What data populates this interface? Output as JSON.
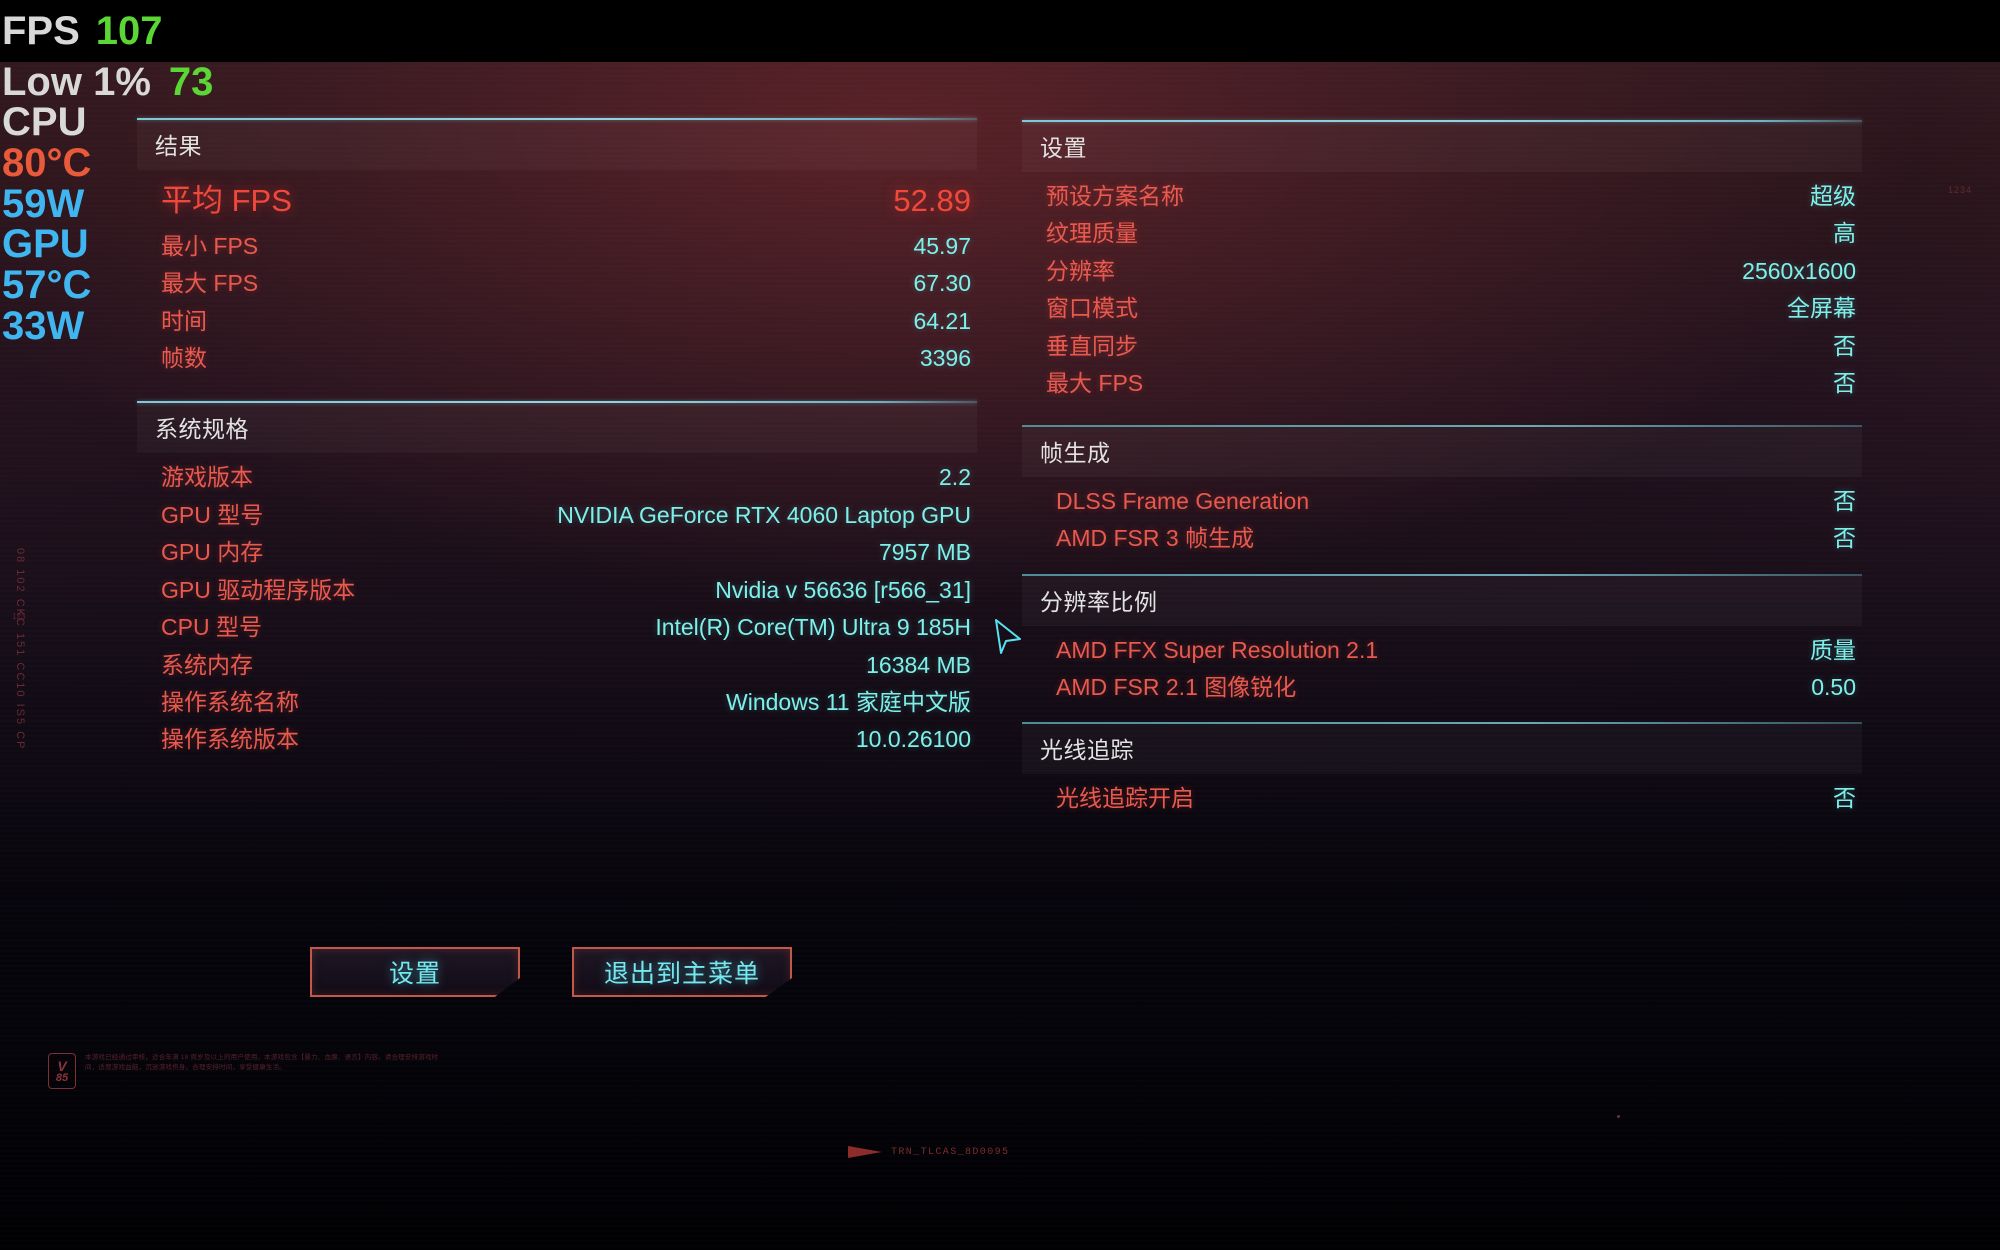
{
  "overlay": {
    "fps_label": "FPS",
    "fps_value": "107",
    "low_label": "Low 1%",
    "low_value": "73",
    "cpu_label": "CPU",
    "cpu_temp": "80°C",
    "cpu_power": "59W",
    "gpu_label": "GPU",
    "gpu_temp": "57°C",
    "gpu_power": "33W",
    "color_label": "#d9d9d9",
    "color_fps": "#5bd635",
    "color_cpu_temp": "#e85a3a",
    "color_gpu": "#3fb6ef"
  },
  "left_panel": {
    "results": {
      "header": "结果",
      "rows": [
        {
          "label": "平均 FPS",
          "value": "52.89",
          "hero": true
        },
        {
          "label": "最小 FPS",
          "value": "45.97",
          "hero": false
        },
        {
          "label": "最大 FPS",
          "value": "67.30",
          "hero": false
        },
        {
          "label": "时间",
          "value": "64.21",
          "hero": false
        },
        {
          "label": "帧数",
          "value": "3396",
          "hero": false
        }
      ]
    },
    "system_specs": {
      "header": "系统规格",
      "rows": [
        {
          "label": "游戏版本",
          "value": "2.2"
        },
        {
          "label": "GPU 型号",
          "value": "NVIDIA GeForce RTX 4060 Laptop GPU"
        },
        {
          "label": "GPU 内存",
          "value": "7957 MB"
        },
        {
          "label": "GPU 驱动程序版本",
          "value": "Nvidia v 56636 [r566_31]"
        },
        {
          "label": "CPU 型号",
          "value": "Intel(R) Core(TM) Ultra 9 185H"
        },
        {
          "label": "系统内存",
          "value": "16384 MB"
        },
        {
          "label": "操作系统名称",
          "value": "Windows 11 家庭中文版"
        },
        {
          "label": "操作系统版本",
          "value": "10.0.26100"
        }
      ]
    }
  },
  "right_panel": {
    "settings": {
      "header": "设置",
      "rows": [
        {
          "label": "预设方案名称",
          "value": "超级"
        },
        {
          "label": "纹理质量",
          "value": "高"
        },
        {
          "label": "分辨率",
          "value": "2560x1600"
        },
        {
          "label": "窗口模式",
          "value": "全屏幕"
        },
        {
          "label": "垂直同步",
          "value": "否"
        },
        {
          "label": "最大 FPS",
          "value": "否"
        }
      ]
    },
    "frame_generation": {
      "header": "帧生成",
      "rows": [
        {
          "label": "DLSS Frame Generation",
          "value": "否"
        },
        {
          "label": "AMD FSR 3 帧生成",
          "value": "否"
        }
      ]
    },
    "resolution_scaling": {
      "header": "分辨率比例",
      "rows": [
        {
          "label": "AMD FFX Super Resolution 2.1",
          "value": "质量"
        },
        {
          "label": "AMD FSR 2.1 图像锐化",
          "value": "0.50"
        }
      ]
    },
    "ray_tracing": {
      "header": "光线追踪",
      "rows": [
        {
          "label": "光线追踪开启",
          "value": "否"
        }
      ]
    }
  },
  "buttons": {
    "settings": "设置",
    "quit_to_main_menu": "退出到主菜单"
  },
  "decorations": {
    "vertical_code": "08 102 CKC 151 CC10 IS5 CP",
    "vertical_code_small": "123",
    "rating_line1": "V",
    "rating_line2": "85",
    "legal_text": "本游戏已经通过审核，适合年满 18 周岁及以上的用户使用。本游戏包含【暴力、血腺、语言】内容。请合理安排游戏时间，适度游戏益脑，沉迷游戏伤身。合理安排时间，享受健康生活。",
    "trn_mark": "TRN_TLCAS_8D0095",
    "corner_mark": "1234"
  }
}
